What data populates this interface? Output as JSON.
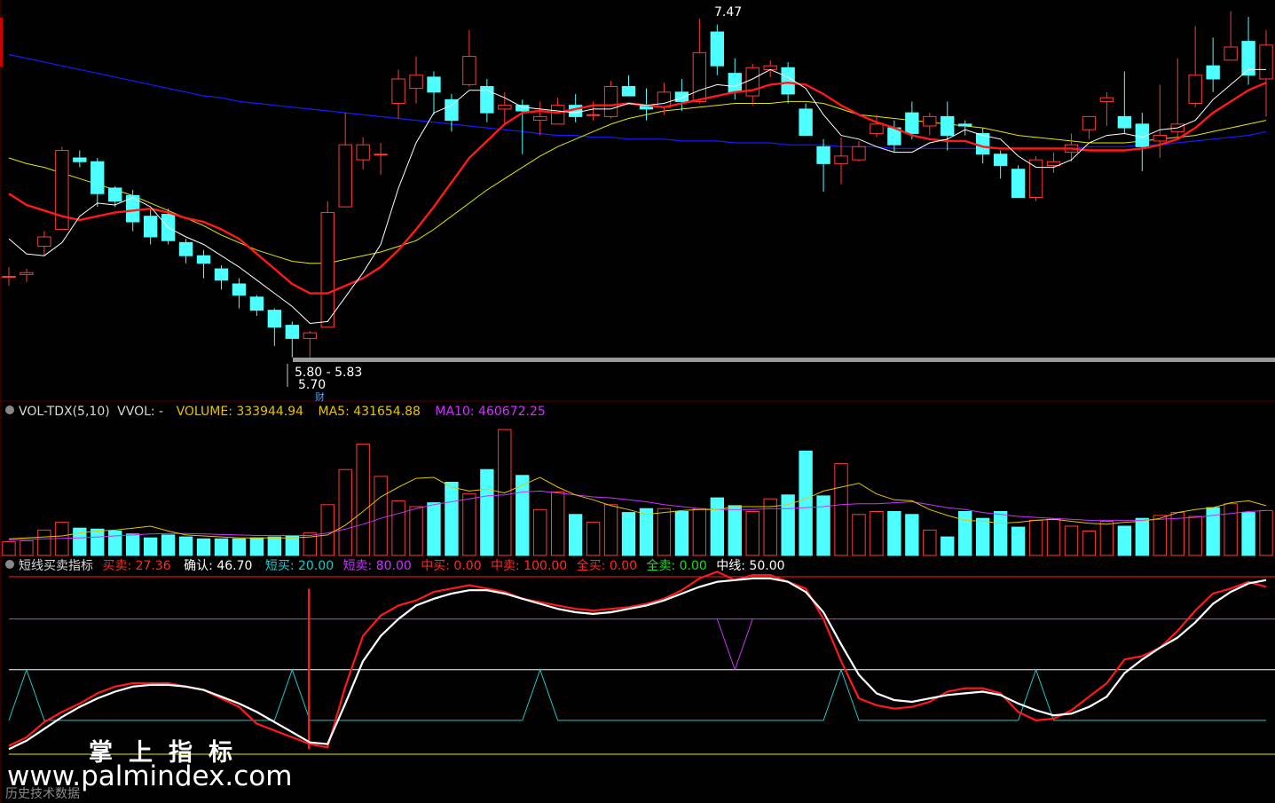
{
  "colors": {
    "up": "#ff3b3b",
    "down": "#4dffff",
    "ma_short": "#ffffff",
    "ma_red": "#ff1a1a",
    "ma_yellow": "#e6e600",
    "ma_blue": "#1a1aff",
    "grid": "#600000",
    "vol_ma5": "#e6c300",
    "vol_ma10": "#cc33ff",
    "buy_sell": "#ff1a1a",
    "confirm": "#ffffff",
    "short_buy": "#1ec8c8",
    "short_sell": "#cc33ff",
    "mid_line": "#ffffff",
    "full_sell_line": "#e6e600"
  },
  "price_panel": {
    "high_label": "7.47",
    "range_label": "5.80 - 5.83",
    "low_label": "5.70",
    "tag": "财"
  },
  "volume_panel": {
    "name": "VOL-TDX(5,10)",
    "vvol": "VVOL: -",
    "volume": "VOLUME: 333944.94",
    "ma5": "MA5: 431654.88",
    "ma10": "MA10: 460672.25"
  },
  "indicator_panel": {
    "name": "短线买卖指标",
    "buy_sell": "买卖: 27.36",
    "confirm": "确认: 46.70",
    "short_buy": "短买: 20.00",
    "short_sell": "短卖: 80.00",
    "mid_buy": "中买: 0.00",
    "mid_sell": "中卖: 100.00",
    "full_buy": "全买: 0.00",
    "full_sell": "全卖: 0.00",
    "mid_line": "中线: 50.00"
  },
  "watermark": {
    "brand_cn": "掌上指标",
    "url": "www.palmindex.com",
    "sub": "历史技术数据"
  },
  "chart_data": {
    "type": "candlestick",
    "price_ylim": [
      5.5,
      7.6
    ],
    "candles": [
      [
        6.13,
        6.13,
        6.18,
        6.08
      ],
      [
        6.14,
        6.15,
        6.17,
        6.1
      ],
      [
        6.29,
        6.34,
        6.37,
        6.24
      ],
      [
        6.38,
        6.8,
        6.82,
        6.38
      ],
      [
        6.76,
        6.74,
        6.8,
        6.71
      ],
      [
        6.74,
        6.57,
        6.76,
        6.5
      ],
      [
        6.6,
        6.53,
        6.61,
        6.5
      ],
      [
        6.56,
        6.42,
        6.59,
        6.37
      ],
      [
        6.45,
        6.34,
        6.49,
        6.3
      ],
      [
        6.46,
        6.32,
        6.49,
        6.3
      ],
      [
        6.31,
        6.24,
        6.33,
        6.2
      ],
      [
        6.24,
        6.2,
        6.27,
        6.12
      ],
      [
        6.17,
        6.11,
        6.19,
        6.06
      ],
      [
        6.09,
        6.03,
        6.12,
        5.96
      ],
      [
        6.02,
        5.95,
        6.03,
        5.92
      ],
      [
        5.95,
        5.86,
        5.96,
        5.76
      ],
      [
        5.87,
        5.8,
        5.89,
        5.7
      ],
      [
        5.8,
        5.83,
        5.84,
        5.7
      ],
      [
        5.86,
        6.47,
        6.53,
        5.86
      ],
      [
        6.5,
        6.83,
        7.0,
        6.5
      ],
      [
        6.75,
        6.83,
        6.87,
        6.7
      ],
      [
        6.78,
        6.78,
        6.84,
        6.67
      ],
      [
        7.05,
        7.18,
        7.23,
        6.97
      ],
      [
        7.13,
        7.2,
        7.3,
        7.05
      ],
      [
        7.19,
        7.11,
        7.22,
        6.99
      ],
      [
        7.07,
        6.96,
        7.1,
        6.9
      ],
      [
        7.15,
        7.3,
        7.44,
        7.14
      ],
      [
        7.14,
        7.0,
        7.18,
        6.95
      ],
      [
        7.02,
        7.04,
        7.11,
        6.94
      ],
      [
        7.04,
        7.01,
        7.07,
        6.78
      ],
      [
        6.96,
        6.98,
        7.06,
        6.88
      ],
      [
        6.94,
        7.04,
        7.08,
        6.94
      ],
      [
        7.04,
        6.98,
        7.1,
        6.95
      ],
      [
        6.99,
        6.99,
        7.06,
        6.96
      ],
      [
        6.98,
        7.14,
        7.17,
        6.97
      ],
      [
        7.14,
        7.09,
        7.2,
        7.09
      ],
      [
        7.04,
        7.02,
        7.13,
        6.96
      ],
      [
        7.03,
        7.11,
        7.16,
        6.99
      ],
      [
        7.11,
        7.06,
        7.18,
        7.01
      ],
      [
        7.06,
        7.32,
        7.5,
        7.05
      ],
      [
        7.43,
        7.25,
        7.47,
        7.2
      ],
      [
        7.21,
        7.11,
        7.29,
        7.07
      ],
      [
        7.09,
        7.24,
        7.26,
        7.04
      ],
      [
        7.23,
        7.25,
        7.28,
        7.19
      ],
      [
        7.24,
        7.1,
        7.27,
        7.05
      ],
      [
        7.02,
        6.88,
        7.05,
        6.88
      ],
      [
        6.82,
        6.73,
        6.86,
        6.58
      ],
      [
        6.73,
        6.77,
        6.87,
        6.62
      ],
      [
        6.75,
        6.82,
        6.85,
        6.74
      ],
      [
        6.89,
        6.94,
        6.99,
        6.87
      ],
      [
        6.92,
        6.83,
        6.96,
        6.79
      ],
      [
        7.0,
        6.89,
        7.06,
        6.86
      ],
      [
        6.93,
        6.98,
        7.0,
        6.88
      ],
      [
        6.98,
        6.88,
        7.06,
        6.8
      ],
      [
        6.94,
        6.93,
        6.96,
        6.88
      ],
      [
        6.89,
        6.78,
        6.92,
        6.73
      ],
      [
        6.78,
        6.72,
        6.8,
        6.65
      ],
      [
        6.7,
        6.55,
        6.72,
        6.55
      ],
      [
        6.55,
        6.75,
        6.77,
        6.53
      ],
      [
        6.72,
        6.74,
        6.79,
        6.68
      ],
      [
        6.79,
        6.83,
        6.89,
        6.74
      ],
      [
        6.91,
        6.98,
        6.98,
        6.86
      ],
      [
        7.06,
        7.08,
        7.11,
        6.93
      ],
      [
        6.98,
        6.92,
        7.22,
        6.89
      ],
      [
        6.94,
        6.82,
        7.0,
        6.69
      ],
      [
        6.85,
        6.88,
        7.15,
        6.76
      ],
      [
        6.9,
        6.94,
        7.29,
        6.86
      ],
      [
        7.05,
        7.2,
        7.46,
        7.03
      ],
      [
        7.25,
        7.18,
        7.4,
        7.11
      ],
      [
        7.28,
        7.35,
        7.54,
        7.28
      ],
      [
        7.38,
        7.2,
        7.51,
        7.15
      ],
      [
        7.18,
        7.36,
        7.44,
        6.98
      ]
    ],
    "ma_short": [
      6.33,
      6.25,
      6.24,
      6.31,
      6.45,
      6.52,
      6.51,
      6.55,
      6.5,
      6.39,
      6.34,
      6.3,
      6.24,
      6.18,
      6.11,
      6.04,
      5.97,
      5.88,
      5.89,
      6.02,
      6.15,
      6.3,
      6.6,
      6.84,
      7.0,
      7.04,
      7.12,
      7.12,
      7.08,
      7.03,
      7.02,
      7.01,
      7.0,
      7.02,
      7.02,
      7.05,
      7.04,
      7.05,
      7.08,
      7.12,
      7.15,
      7.14,
      7.18,
      7.23,
      7.19,
      7.13,
      6.99,
      6.88,
      6.86,
      6.82,
      6.79,
      6.79,
      6.84,
      6.86,
      6.91,
      6.88,
      6.86,
      6.77,
      6.71,
      6.71,
      6.75,
      6.84,
      6.88,
      6.89,
      6.87,
      6.91,
      6.92,
      6.96,
      7.07,
      7.15,
      7.23,
      7.23
    ],
    "ma_red": [
      6.57,
      6.51,
      6.48,
      6.45,
      6.43,
      6.45,
      6.47,
      6.48,
      6.49,
      6.47,
      6.44,
      6.42,
      6.38,
      6.33,
      6.25,
      6.17,
      6.09,
      6.04,
      6.04,
      6.08,
      6.12,
      6.18,
      6.27,
      6.38,
      6.5,
      6.63,
      6.76,
      6.85,
      6.94,
      7.0,
      7.01,
      7.0,
      7.02,
      7.04,
      7.04,
      7.05,
      7.04,
      7.03,
      7.05,
      7.07,
      7.09,
      7.11,
      7.12,
      7.15,
      7.16,
      7.15,
      7.1,
      7.04,
      6.99,
      6.95,
      6.92,
      6.88,
      6.86,
      6.85,
      6.85,
      6.82,
      6.81,
      6.81,
      6.81,
      6.81,
      6.81,
      6.8,
      6.8,
      6.8,
      6.81,
      6.83,
      6.86,
      6.92,
      7.0,
      7.06,
      7.12,
      7.16
    ],
    "ma_yellow": [
      6.76,
      6.73,
      6.71,
      6.68,
      6.65,
      6.62,
      6.59,
      6.56,
      6.52,
      6.48,
      6.44,
      6.4,
      6.35,
      6.31,
      6.27,
      6.24,
      6.21,
      6.2,
      6.2,
      6.22,
      6.24,
      6.26,
      6.29,
      6.32,
      6.38,
      6.45,
      6.52,
      6.59,
      6.65,
      6.71,
      6.77,
      6.82,
      6.86,
      6.9,
      6.94,
      6.97,
      6.99,
      7.01,
      7.02,
      7.03,
      7.04,
      7.05,
      7.05,
      7.05,
      7.06,
      7.06,
      7.05,
      7.02,
      6.99,
      6.98,
      6.97,
      6.96,
      6.95,
      6.94,
      6.93,
      6.92,
      6.9,
      6.88,
      6.87,
      6.86,
      6.85,
      6.84,
      6.84,
      6.84,
      6.85,
      6.86,
      6.87,
      6.88,
      6.9,
      6.92,
      6.94,
      6.96
    ],
    "ma_blue": [
      7.31,
      7.29,
      7.27,
      7.25,
      7.23,
      7.21,
      7.19,
      7.17,
      7.15,
      7.13,
      7.11,
      7.09,
      7.08,
      7.06,
      7.05,
      7.04,
      7.03,
      7.02,
      7.01,
      7.0,
      6.99,
      6.98,
      6.97,
      6.96,
      6.95,
      6.94,
      6.93,
      6.92,
      6.91,
      6.9,
      6.89,
      6.88,
      6.88,
      6.87,
      6.87,
      6.86,
      6.86,
      6.86,
      6.85,
      6.85,
      6.85,
      6.84,
      6.84,
      6.84,
      6.83,
      6.83,
      6.83,
      6.82,
      6.82,
      6.82,
      6.81,
      6.81,
      6.81,
      6.81,
      6.81,
      6.81,
      6.81,
      6.81,
      6.81,
      6.81,
      6.81,
      6.82,
      6.82,
      6.82,
      6.83,
      6.83,
      6.84,
      6.85,
      6.86,
      6.87,
      6.88,
      6.9
    ],
    "volume_ylim": [
      0,
      1400000
    ],
    "volume": [
      140000,
      150000,
      260000,
      340000,
      280000,
      270000,
      250000,
      220000,
      180000,
      210000,
      190000,
      170000,
      170000,
      170000,
      180000,
      190000,
      200000,
      230000,
      520000,
      880000,
      1140000,
      810000,
      560000,
      500000,
      540000,
      750000,
      630000,
      880000,
      1290000,
      820000,
      470000,
      650000,
      420000,
      340000,
      520000,
      440000,
      480000,
      480000,
      450000,
      480000,
      590000,
      510000,
      450000,
      580000,
      620000,
      1070000,
      610000,
      940000,
      420000,
      450000,
      450000,
      420000,
      260000,
      190000,
      450000,
      380000,
      450000,
      290000,
      360000,
      370000,
      300000,
      250000,
      350000,
      300000,
      380000,
      410000,
      440000,
      400000,
      490000,
      530000,
      440000,
      460000
    ],
    "vol_ma5": [
      170000,
      180000,
      190000,
      200000,
      230000,
      250000,
      260000,
      280000,
      300000,
      250000,
      210000,
      200000,
      190000,
      180000,
      180000,
      180000,
      180000,
      190000,
      210000,
      310000,
      450000,
      600000,
      700000,
      790000,
      800000,
      700000,
      660000,
      680000,
      640000,
      720000,
      800000,
      700000,
      620000,
      570000,
      510000,
      470000,
      420000,
      440000,
      460000,
      470000,
      470000,
      500000,
      500000,
      500000,
      520000,
      580000,
      660000,
      700000,
      740000,
      630000,
      570000,
      560000,
      470000,
      410000,
      360000,
      350000,
      330000,
      340000,
      360000,
      370000,
      350000,
      330000,
      320000,
      340000,
      350000,
      380000,
      440000,
      470000,
      490000,
      540000,
      560000,
      510000
    ],
    "vol_ma10": [
      160000,
      165000,
      170000,
      175000,
      180000,
      190000,
      200000,
      210000,
      220000,
      225000,
      225000,
      220000,
      215000,
      210000,
      205000,
      205000,
      205000,
      205000,
      230000,
      270000,
      320000,
      380000,
      430000,
      480000,
      520000,
      550000,
      580000,
      610000,
      620000,
      650000,
      660000,
      640000,
      620000,
      600000,
      590000,
      570000,
      550000,
      520000,
      500000,
      480000,
      470000,
      470000,
      470000,
      480000,
      480000,
      490000,
      500000,
      520000,
      530000,
      530000,
      540000,
      550000,
      520000,
      490000,
      470000,
      440000,
      420000,
      400000,
      390000,
      380000,
      370000,
      360000,
      360000,
      360000,
      360000,
      370000,
      380000,
      390000,
      410000,
      430000,
      450000,
      460000
    ],
    "indicator_ylim": [
      0,
      105
    ],
    "buy_sell": [
      5,
      10,
      19,
      25,
      30,
      36,
      40,
      42,
      42,
      42,
      40,
      38,
      33,
      28,
      18,
      14,
      10,
      6,
      4,
      40,
      70,
      82,
      88,
      91,
      96,
      98,
      100,
      98,
      96,
      92,
      90,
      88,
      86,
      85,
      86,
      87,
      89,
      92,
      97,
      104,
      108,
      103,
      106,
      106,
      102,
      98,
      80,
      55,
      33,
      29,
      27,
      28,
      31,
      37,
      39,
      39,
      36,
      25,
      20,
      21,
      26,
      34,
      42,
      56,
      58,
      63,
      73,
      85,
      95,
      98,
      102,
      99
    ],
    "confirm": [
      3,
      8,
      15,
      22,
      28,
      33,
      37,
      40,
      41,
      41,
      40,
      38,
      34,
      30,
      25,
      19,
      13,
      7,
      6,
      30,
      55,
      70,
      80,
      88,
      92,
      95,
      97,
      97,
      95,
      92,
      89,
      86,
      84,
      83,
      84,
      86,
      88,
      91,
      95,
      99,
      102,
      103,
      104,
      104,
      102,
      96,
      84,
      65,
      47,
      36,
      32,
      31,
      33,
      35,
      36,
      37,
      35,
      30,
      26,
      23,
      24,
      28,
      34,
      48,
      56,
      63,
      69,
      78,
      89,
      96,
      101,
      103
    ],
    "short_buy_line": 20,
    "short_sell_line": 80,
    "mid_line": 50,
    "full_sell_line": 0
  }
}
